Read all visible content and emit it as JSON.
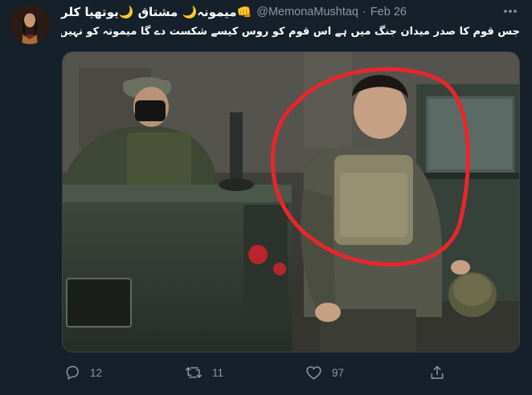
{
  "tweet": {
    "display_name": "میمونہ🌙 مشتاق 🌙یوتھیا کلر👊",
    "handle": "@MemonaMushtaq",
    "separator": "·",
    "date": "Feb 26",
    "text": "جس قوم کا صدر میدان جنگ میں ہے اس قوم کو روس کیسے شکست دے گا میمونہ کو نہیں لگتا یوکرین آسانی سے ہار مان جائے گا",
    "more_icon": "ellipsis-icon"
  },
  "actions": {
    "reply": {
      "icon": "reply-icon",
      "count": "12"
    },
    "retweet": {
      "icon": "retweet-icon",
      "count": "11"
    },
    "like": {
      "icon": "heart-icon",
      "count": "97"
    },
    "share": {
      "icon": "share-icon"
    }
  },
  "colors": {
    "background": "#15202b",
    "muted": "#8899a6",
    "circle": "#e8262d"
  }
}
